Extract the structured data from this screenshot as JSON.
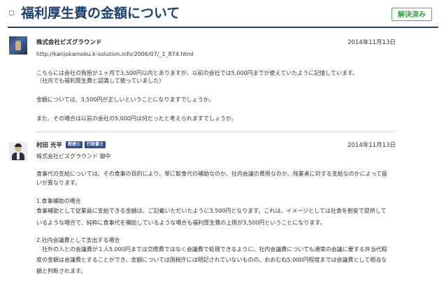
{
  "header": {
    "title": "福利厚生費の金額について",
    "resolved_label": "解決済み"
  },
  "posts": [
    {
      "author": "株式会社ビズグラウンド",
      "date": "2014年11月13日",
      "lines": [
        "http://kanjokamoku.k-solution.info/2006/07/_1_874.html",
        "こちらには会社の負担が１ヶ月で3,500円以内とありますが、以前の会社では5,000円までが使えていたように記憶しています。",
        "（社内でも福利厚生費と認識して使っていました）",
        "金額については、3,500円が正しいということになりますでしょうか。",
        "また、その場合は以前の会社の5,000円は何だったと考えられますでしょうか。"
      ]
    },
    {
      "author": "村田 光平",
      "badges": [
        "税理士",
        "行政書士"
      ],
      "date": "2014年11月13日",
      "lines": [
        "株式会社ビズグラウンド 御中",
        "食事代の支給については、その食事の目的により、単に飲食代の補助なのか、社内会議の費用なのか、残業者に対する支給なのかによって扱",
        "いが異なります。",
        "1.食事補助の場合",
        "食事補助として従業員に支給できる金額は、ご記載いただいたように3,500円となります。これは、イメージとしては社食を割安で提供して",
        "いるような場合で、純粋に食事代を補助しているような場合も福利厚生費の上限が3,500円ということになります。",
        "2.社内会議費として支出する場合",
        "　社外の人との会議費が１人5,000円までは交際費ではなく会議費で処理できるように、社内会議費についても通常の会議に要する弁当代程",
        "度の金額は会議費とすることができ、金額については国税庁には明記されていないものの、おおむね5,000円程度までは会議費として相当な",
        "額と判断されます。"
      ]
    }
  ]
}
